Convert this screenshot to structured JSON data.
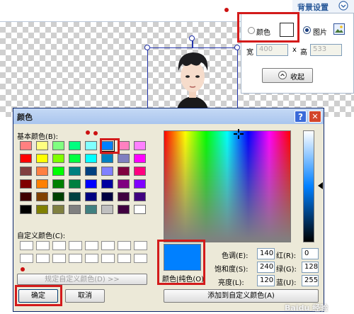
{
  "settings_panel": {
    "title": "背景设置",
    "color_option_label": "颜色",
    "image_option_label": "图片",
    "width_label": "宽",
    "width_placeholder": "400",
    "times_sign": "x",
    "height_label": "高",
    "height_placeholder": "533",
    "collapse_label": "收起"
  },
  "dialog": {
    "title": "颜色",
    "help_glyph": "?",
    "close_glyph": "✕",
    "basic_colors_label": "基本颜色(B):",
    "custom_colors_label": "自定义颜色(C):",
    "define_custom_button": "规定自定义颜色(D) >>",
    "ok_button": "确定",
    "cancel_button": "取消",
    "preview_label": "颜色|纯色(O)",
    "hue_label": "色调(E):",
    "hue_value": "140",
    "sat_label": "饱和度(S):",
    "sat_value": "240",
    "lum_label": "亮度(L):",
    "lum_value": "120",
    "red_label": "红(R):",
    "red_value": "0",
    "green_label": "绿(G):",
    "green_value": "128",
    "blue_label": "蓝(U):",
    "blue_value": "255",
    "add_custom_button": "添加到自定义颜色(A)",
    "basic_colors": [
      [
        "#ff8080",
        "#ffff80",
        "#80ff80",
        "#00ff80",
        "#80ffff",
        "#0080ff",
        "#ff80c0",
        "#ff80ff"
      ],
      [
        "#ff0000",
        "#ffff00",
        "#80ff00",
        "#00ff40",
        "#00ffff",
        "#0080c0",
        "#8080c0",
        "#ff00ff"
      ],
      [
        "#804040",
        "#ff8040",
        "#00ff00",
        "#008080",
        "#004080",
        "#8080ff",
        "#800040",
        "#ff0080"
      ],
      [
        "#800000",
        "#ff8000",
        "#008000",
        "#008040",
        "#0000ff",
        "#0000a0",
        "#800080",
        "#8000ff"
      ],
      [
        "#400000",
        "#804000",
        "#004000",
        "#004040",
        "#000080",
        "#000040",
        "#400040",
        "#400080"
      ],
      [
        "#000000",
        "#808000",
        "#808040",
        "#808080",
        "#408080",
        "#c0c0c0",
        "#400040",
        "#ffffff"
      ]
    ],
    "selected_color": "#0080ff"
  },
  "watermark": "Baidu 经验",
  "colors": {
    "dialog_bg": "#ece9d8",
    "title_bar": "#0a246a",
    "accent_red": "#d31b1b"
  }
}
